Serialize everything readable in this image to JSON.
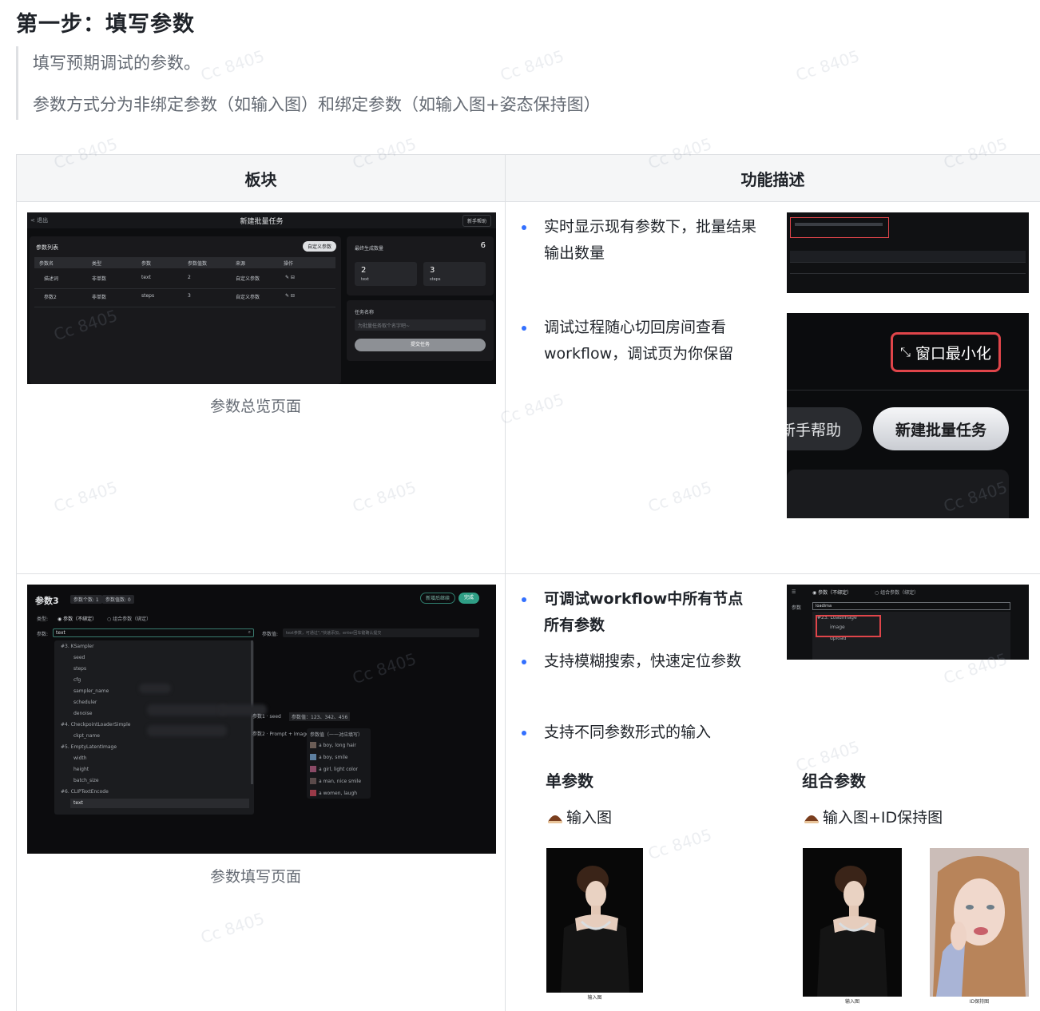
{
  "heading": "第一步：填写参数",
  "quote": {
    "line1": "填写预期调试的参数。",
    "line2": "参数方式分为非绑定参数（如输入图）和绑定参数（如输入图+姿态保持图）"
  },
  "table": {
    "headers": [
      "板块",
      "功能描述"
    ],
    "row1": {
      "caption": "参数总览页面",
      "shot": {
        "back": "< 退出",
        "title": "新建批量任务",
        "help": "新手帮助",
        "panel_title": "参数列表",
        "add_button": "自定义参数",
        "columns": [
          "参数名",
          "类型",
          "参数",
          "参数值数",
          "来源",
          "操作"
        ],
        "rows": [
          [
            "描述词",
            "非单数",
            "text",
            "2",
            "自定义参数"
          ],
          [
            "参数2",
            "非单数",
            "steps",
            "3",
            "自定义参数"
          ]
        ],
        "count_label": "最终生成数量",
        "count_value": "6",
        "box1_value": "2",
        "box1_label": "text",
        "box2_value": "3",
        "box2_label": "steps",
        "task_label": "任务名称",
        "task_placeholder": "为批量任务取个名字吧~",
        "submit": "提交任务"
      },
      "bullets": [
        "实时显示现有参数下，批量结果输出数量",
        "调试过程随心切回房间查看workflow，调试页为你保留"
      ],
      "minimize_label": "窗口最小化",
      "help_pill": "新手帮助",
      "new_task_pill": "新建批量任务"
    },
    "row2": {
      "caption": "参数填写页面",
      "shot": {
        "title": "参数3",
        "tag1": "参数个数: 1",
        "tag2": "参数值数: 0",
        "btn_save": "新增后继续",
        "btn_ok": "完成",
        "type_label": "类型:",
        "opt1": "参数（不绑定）",
        "opt2": "组合参数（绑定）",
        "param_label": "参数:",
        "search_value": "text",
        "value_label": "参数值:",
        "value_placeholder": "text参数，可通过\",\"快速添加，enter回车键确认提交",
        "tree": [
          "#3. KSampler",
          "seed",
          "steps",
          "cfg",
          "sampler_name",
          "scheduler",
          "denoise",
          "#4. CheckpointLoaderSimple",
          "ckpt_name",
          "#5. EmptyLatentImage",
          "width",
          "height",
          "batch_size",
          "#6. CLIPTextEncode",
          "text"
        ],
        "seed_label": "参数1 · seed",
        "seed_values": "参数值：123、342、456",
        "prompt_label": "参数2 · Prompt + Image",
        "pop_title": "参数值（一一对应填写）",
        "pop_items": [
          "a boy, long hair",
          "a boy, smile",
          "a girl, light color",
          "a man, nice smile",
          "a women, laugh"
        ]
      },
      "bullets": [
        "可调试workflow中所有节点所有参数",
        "支持模糊搜索，快速定位参数",
        "支持不同参数形式的输入"
      ],
      "shot5": {
        "opt1": "参数（不绑定）",
        "opt2": "组合参数（绑定）",
        "param_label": "参数",
        "search_value": "loadima",
        "node": "#23. LoadImage",
        "item1": "image",
        "item2": "upload"
      },
      "single": {
        "title": "单参数",
        "item": "输入图",
        "photo_caption": "输入图"
      },
      "combo": {
        "title": "组合参数",
        "item": "输入图+ID保持图",
        "photo1_caption": "输入图",
        "photo2_caption": "ID保持图"
      }
    }
  },
  "watermark": "Cc 8405"
}
